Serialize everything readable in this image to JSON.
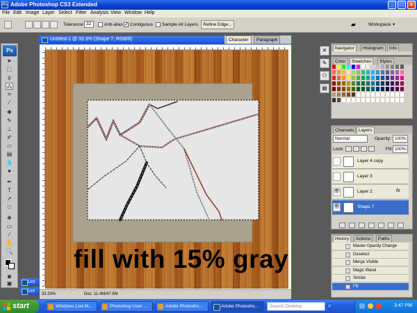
{
  "app": {
    "title": "Adobe Photoshop CS3 Extended",
    "logo": "Ps"
  },
  "menu": [
    "File",
    "Edit",
    "Image",
    "Layer",
    "Select",
    "Filter",
    "Analysis",
    "View",
    "Window",
    "Help"
  ],
  "options": {
    "tolerance_label": "Tolerance:",
    "tolerance_value": "32",
    "antialias_label": "Anti-alias",
    "antialias_checked": false,
    "contiguous_label": "Contiguous",
    "contiguous_checked": true,
    "sample_all_label": "Sample All Layers",
    "sample_all_checked": false,
    "refine_edge_label": "Refine Edge...",
    "workspace_label": "Workspace"
  },
  "document": {
    "title": "Untitled-1 @ 33.3% (Shape 7, RGB/8)",
    "zoom": "33.33%",
    "doc_info": "Doc: 11.4M/47.6M"
  },
  "minimized_docs": [
    "Unt",
    "Unt"
  ],
  "caption": "fill with 15% gray",
  "char_tabs": [
    "Character",
    "Paragraph"
  ],
  "panels": {
    "navigator_tabs": [
      "Navigator",
      "Histogram",
      "Info"
    ],
    "color_tabs": [
      "Color",
      "Swatches",
      "Styles"
    ],
    "layers": {
      "tabs": [
        "Channels",
        "Layers"
      ],
      "blend_mode": "Normal",
      "opacity_label": "Opacity:",
      "opacity": "100%",
      "lock_label": "Lock:",
      "fill_label": "Fill:",
      "fill": "100%",
      "items": [
        {
          "name": "Layer 4 copy",
          "visible": false,
          "selected": false,
          "fx": false
        },
        {
          "name": "Layer 3",
          "visible": false,
          "selected": false,
          "fx": false
        },
        {
          "name": "Layer 2",
          "visible": true,
          "selected": false,
          "fx": true
        },
        {
          "name": "Shape 7",
          "visible": true,
          "selected": true,
          "fx": false
        }
      ],
      "fx_label": "fx"
    },
    "history": {
      "tabs": [
        "History",
        "Actions",
        "Paths"
      ],
      "items": [
        "Master Opacity Change",
        "Deselect",
        "Merge Visible",
        "Magic Wand",
        "Similar",
        "Fill"
      ],
      "selected": "Fill"
    }
  },
  "swatch_colors": {
    "row1": [
      "#ff0000",
      "#ffff00",
      "#00ff00",
      "#00ffff",
      "#0000ff",
      "#ff00ff",
      "#ffffff",
      "#ebebeb",
      "#d6d6d6",
      "#c2c2c2",
      "#adadad",
      "#999999",
      "#858585",
      "#707070",
      "#5c5c5c"
    ],
    "row2": [
      "#f26c4f",
      "#f68e55",
      "#fbaf5c",
      "#fff467",
      "#acd372",
      "#7cc576",
      "#3bb878",
      "#1abbb4",
      "#00bff3",
      "#438ccb",
      "#5574b9",
      "#605ca8",
      "#855fa8",
      "#a763a8",
      "#f06ea9"
    ],
    "row3": [
      "#ed1c24",
      "#f26522",
      "#f7941d",
      "#fff200",
      "#8dc63f",
      "#39b54a",
      "#00a651",
      "#00a99d",
      "#00aeef",
      "#0072bc",
      "#0054a6",
      "#2e3192",
      "#662d91",
      "#92278f",
      "#ec008c"
    ],
    "row4": [
      "#9e0b0f",
      "#a0410d",
      "#a36209",
      "#aba000",
      "#598527",
      "#1a7b30",
      "#007236",
      "#00746b",
      "#0076a3",
      "#004b80",
      "#003471",
      "#1b1464",
      "#440e62",
      "#630460",
      "#9e005d"
    ],
    "row5": [
      "#790000",
      "#7b2e00",
      "#7d4900",
      "#827b00",
      "#406618",
      "#005e20",
      "#005826",
      "#005952",
      "#005b7f",
      "#003663",
      "#002157",
      "#0d004c",
      "#32004b",
      "#4b0049",
      "#7b0046"
    ],
    "row6": [
      "#c69c6d",
      "#a67c52",
      "#8c6239",
      "#754c24",
      "#603913",
      "#ffffff",
      "#ffffff",
      "#ffffff",
      "#ffffff",
      "#ffffff",
      "#ffffff",
      "#ffffff",
      "#ffffff",
      "#ffffff",
      "#ffffff"
    ],
    "row7": [
      "#362f2d",
      "#534741",
      "#ffffff",
      "#ffffff",
      "#ffffff",
      "#ffffff",
      "#ffffff",
      "#ffffff",
      "#ffffff",
      "#ffffff",
      "#ffffff",
      "#ffffff",
      "#ffffff",
      "#ffffff",
      "#ffffff"
    ]
  },
  "taskbar": {
    "start": "start",
    "items": [
      {
        "label": "Windows Live M...",
        "active": false,
        "ps": false
      },
      {
        "label": "Photoshop User ...",
        "active": false,
        "ps": false
      },
      {
        "label": "Adobe Photosho...",
        "active": false,
        "ps": false
      },
      {
        "label": "Adobe Photosho...",
        "active": true,
        "ps": true
      }
    ],
    "search_placeholder": "Search Desktop",
    "clock": "3:47 PM"
  },
  "colors": {
    "accent": "#245edb",
    "selection": "#3a6cc8",
    "mat": "#aaa28e",
    "wood": "#b8702e"
  }
}
